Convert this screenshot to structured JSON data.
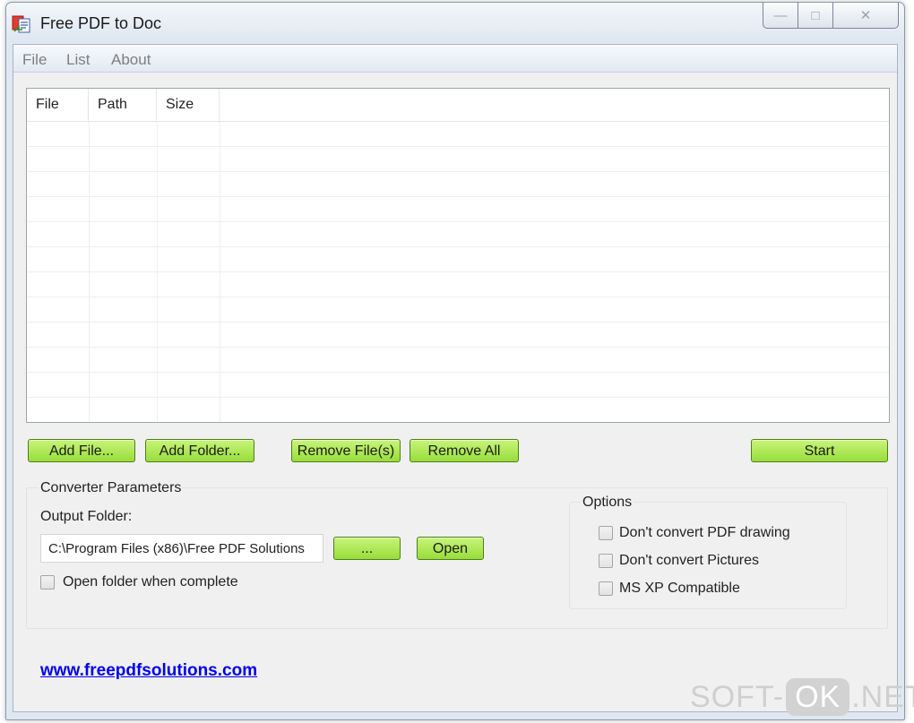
{
  "window": {
    "title": "Free PDF to Doc",
    "app_icon": "pdf-to-doc-app-icon"
  },
  "window_controls": {
    "minimize": "—",
    "maximize": "□",
    "close": "✕"
  },
  "menu": [
    "File",
    "List",
    "About"
  ],
  "file_list": {
    "columns": [
      "File",
      "Path",
      "Size"
    ],
    "rows": []
  },
  "buttons": {
    "add_file": "Add File...",
    "add_folder": "Add Folder...",
    "remove_files": "Remove File(s)",
    "remove_all": "Remove All",
    "start": "Start",
    "browse": "...",
    "open": "Open"
  },
  "converter": {
    "group_title": "Converter Parameters",
    "output_folder_label": "Output Folder:",
    "output_folder_value": "C:\\Program Files (x86)\\Free PDF Solutions",
    "open_when_complete": {
      "label": "Open folder when complete",
      "checked": false
    }
  },
  "options": {
    "title": "Options",
    "items": [
      {
        "label": "Don't convert PDF drawing",
        "checked": false
      },
      {
        "label": "Don't convert Pictures",
        "checked": false
      },
      {
        "label": "MS XP Compatible",
        "checked": false
      }
    ]
  },
  "website": {
    "text": "www.freepdfsolutions.com"
  },
  "watermark": {
    "left": "SOFT-",
    "ok": "OK",
    "right": ".NET"
  },
  "colors": {
    "button_green": "#a8e34c",
    "link": "#0000ee",
    "menu_text": "#7f7f7f"
  }
}
